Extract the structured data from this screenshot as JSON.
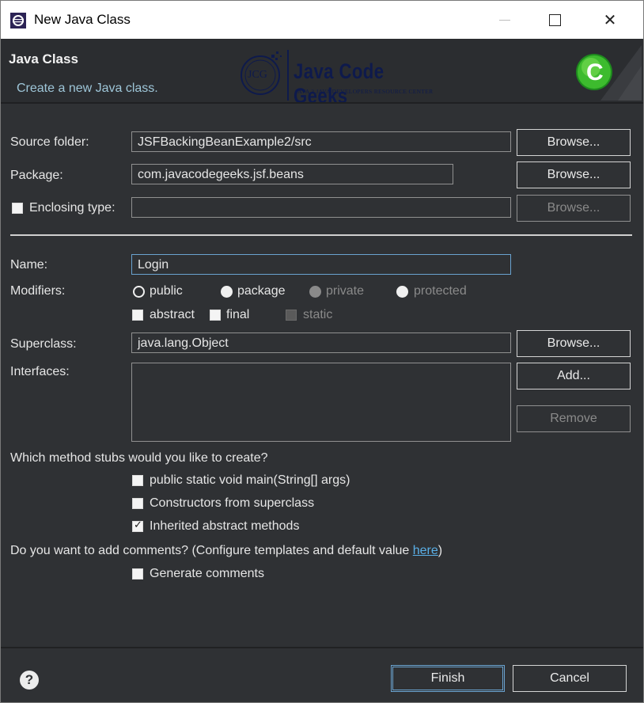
{
  "window": {
    "title": "New Java Class",
    "title_icon": "eclipse-icon"
  },
  "titlebar_buttons": {
    "minimize": "minimize-icon",
    "maximize": "maximize-icon",
    "close": "close-icon",
    "close_glyph": "✕"
  },
  "header": {
    "title": "Java Class",
    "description": "Create a new Java class.",
    "logo_name": "Java Code Geeks",
    "logo_badge": "JCG",
    "logo_tagline": "JAVA 2 JAVA DEVELOPERS RESOURCE CENTER",
    "wizard_icon": "new-class-c-icon",
    "wizard_glyph": "C"
  },
  "form": {
    "source_folder": {
      "label": "Source folder:",
      "value": "JSFBackingBeanExample2/src",
      "button": "Browse..."
    },
    "package": {
      "label": "Package:",
      "value": "com.javacodegeeks.jsf.beans",
      "button": "Browse..."
    },
    "enclosing_type": {
      "label": "Enclosing type:",
      "value": "",
      "button": "Browse...",
      "checked": false
    },
    "name": {
      "label": "Name:",
      "value": "Login"
    },
    "modifiers": {
      "label": "Modifiers:",
      "radios": [
        "public",
        "package",
        "private",
        "protected"
      ],
      "checkboxes": [
        "abstract",
        "final",
        "static"
      ]
    },
    "superclass": {
      "label": "Superclass:",
      "value": "java.lang.Object",
      "button": "Browse..."
    },
    "interfaces": {
      "label": "Interfaces:",
      "add_button": "Add...",
      "remove_button": "Remove"
    }
  },
  "stubs": {
    "question": "Which method stubs would you like to create?",
    "options": [
      {
        "label": "public static void main(String[] args)",
        "checked": false
      },
      {
        "label": "Constructors from superclass",
        "checked": false
      },
      {
        "label": "Inherited abstract methods",
        "checked": true
      }
    ]
  },
  "comments": {
    "question": "Do you want to add comments? (Configure templates and default value ",
    "link": "here",
    "suffix": ")",
    "option": "Generate comments",
    "checked": false
  },
  "footer": {
    "help_glyph": "?",
    "finish": "Finish",
    "cancel": "Cancel"
  },
  "colors": {
    "background": "#2f3134",
    "header_bg": "#2b2d30",
    "link": "#5ab0e8",
    "focus": "#6aa3d0"
  },
  "checkmark": "✓"
}
